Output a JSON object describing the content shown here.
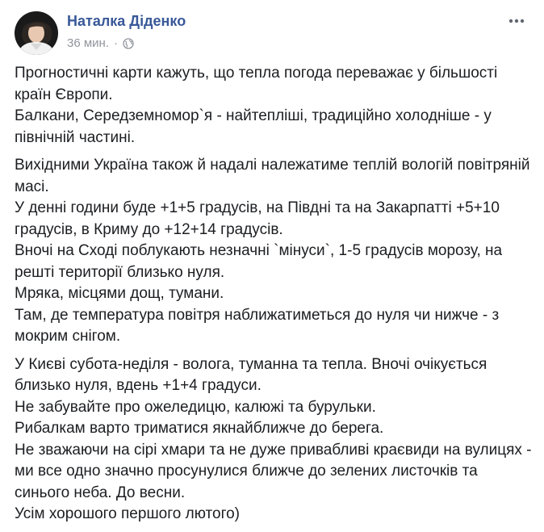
{
  "author": {
    "name": "Наталка Діденко",
    "avatar_icon": "profile-photo"
  },
  "meta": {
    "time": "36 мин.",
    "separator": "·",
    "audience_icon": "globe-icon"
  },
  "more_icon": "ellipsis-icon",
  "colors": {
    "name": "#385898",
    "meta": "#90949c",
    "text": "#1c1e21"
  },
  "body": {
    "paragraphs": [
      [
        "Прогностичні карти кажуть, що тепла погода переважає у більшості",
        "країн Європи.",
        "Балкани, Середземномор`я - найтепліші, традиційно холодніше - у",
        "північній частині."
      ],
      [
        "Вихідними Україна також й надалі належатиме теплій вологій повітряній",
        "масі.",
        "У денні години буде +1+5 градусів, на Півдні та на Закарпатті +5+10",
        "градусів, в Криму до +12+14 градусів.",
        "Вночі на Сході поблукають незначні `мінуси`, 1-5 градусів морозу, на",
        "решті території близько нуля.",
        "Мряка, місцями дощ, тумани.",
        "Там, де температура повітря наближатиметься до нуля чи нижче - з",
        "мокрим снігом."
      ],
      [
        "У Києві субота-неділя - волога, туманна та тепла. Вночі очікується",
        "близько нуля, вдень +1+4 градуси.",
        "Не забувайте про ожеледицю, калюжі та бурульки.",
        "Рибалкам варто триматися якнайближче до берега.",
        "Не зважаючи на сірі хмари та не дуже привабливі краєвиди на вулицях -",
        "ми все одно значно просунулися ближче до зелених листочків та",
        "синього неба. До весни.",
        "Усім хорошого першого лютого)"
      ]
    ]
  }
}
